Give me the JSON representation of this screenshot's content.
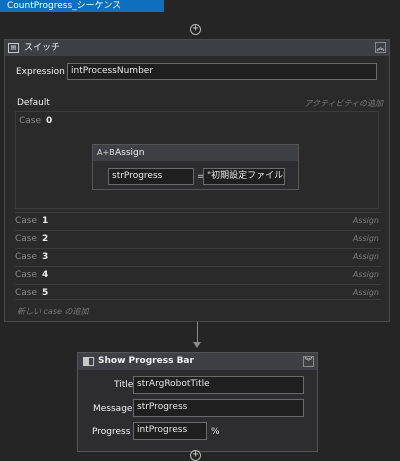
{
  "sequence": {
    "title": "CountProgress_シーケンス"
  },
  "switch_activity": {
    "title": "スイッチ",
    "icon": "switch-icon",
    "expression_label": "Expression",
    "expression_value": "intProcessNumber",
    "default_label": "Default",
    "add_activity_hint": "アクティビティの追加",
    "case0_word": "Case",
    "case0_value": "0",
    "assign": {
      "title": "Assign",
      "icon": "assign-icon",
      "left": "strProgress",
      "op": "=",
      "right": "\"初期設定ファイル読"
    },
    "cases": [
      {
        "word": "Case",
        "value": "1",
        "action": "Assign"
      },
      {
        "word": "Case",
        "value": "2",
        "action": "Assign"
      },
      {
        "word": "Case",
        "value": "3",
        "action": "Assign"
      },
      {
        "word": "Case",
        "value": "4",
        "action": "Assign"
      },
      {
        "word": "Case",
        "value": "5",
        "action": "Assign"
      }
    ],
    "add_case_hint": "新しい case の追加"
  },
  "show_progress_bar": {
    "title": "Show Progress Bar",
    "icon": "progress-bar-icon",
    "title_label": "Title",
    "title_value": "strArgRobotTitle",
    "message_label": "Message",
    "message_value": "strProgress",
    "progress_label": "Progress",
    "progress_value": "intProgress",
    "percent": "%"
  },
  "colors": {
    "accent": "#0e6fc0",
    "background": "#252526",
    "header": "#3f3f46"
  }
}
